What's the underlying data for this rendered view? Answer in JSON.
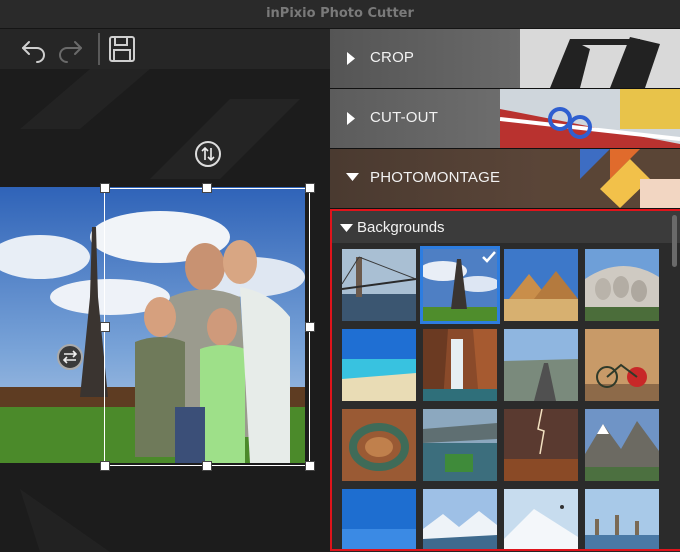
{
  "window": {
    "title": "inPixio Photo Cutter"
  },
  "toolbar": {
    "undo_icon": "undo-arrow-icon",
    "redo_icon": "redo-arrow-icon",
    "save_icon": "floppy-disk-icon"
  },
  "sections": [
    {
      "label": "CROP",
      "state": "collapsed"
    },
    {
      "label": "CUT-OUT",
      "state": "collapsed"
    },
    {
      "label": "PHOTOMONTAGE",
      "state": "expanded"
    }
  ],
  "backgrounds": {
    "label": "Backgrounds",
    "selected_index": 1,
    "thumbnails": [
      "brooklyn-bridge",
      "eiffel-tower",
      "pyramids",
      "mount-rushmore",
      "tropical-beach",
      "waterfall-canyon",
      "desert-road",
      "red-bicycle-wall",
      "horseshoe-bend",
      "lake-football-field",
      "lightning-storm",
      "mountain-valley",
      "blue-sky",
      "snowy-mountains",
      "snow-peaks",
      "harbor-city"
    ]
  },
  "colors": {
    "selection": "#2d7de0",
    "highlight_border": "#e0141b"
  }
}
